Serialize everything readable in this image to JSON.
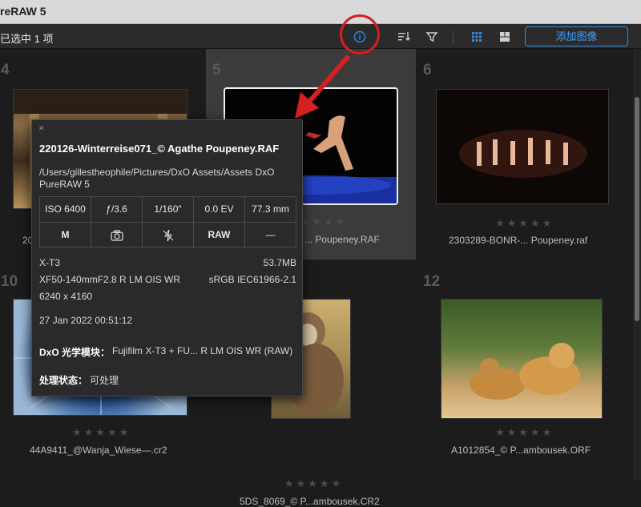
{
  "window": {
    "title": "reRAW 5"
  },
  "toolbar": {
    "selection_text": "已选中 1 项",
    "add_images_label": "添加图像",
    "icons": [
      "info-icon",
      "sort-icon",
      "filter-icon",
      "grid-view-icon",
      "compare-view-icon"
    ],
    "accent_color": "#2d8ce6"
  },
  "grid": {
    "cells": [
      {
        "number": "4",
        "stars": "★★★★★",
        "filename": "20"
      },
      {
        "number": "5",
        "stars": "★★★★★",
        "filename": "... Poupeney.RAF"
      },
      {
        "number": "6",
        "stars": "★★★★★",
        "filename": "2303289-BONR-... Poupeney.raf"
      },
      {
        "number": "10",
        "stars": "★★★★★",
        "filename": "44A9411_@Wanja_Wiese—.cr2"
      },
      {
        "number": "",
        "stars": "★★★★★",
        "filename": "5DS_8069_© P...ambousek.CR2"
      },
      {
        "number": "12",
        "stars": "★★★★★",
        "filename": "A1012854_© P...ambousek.ORF"
      }
    ],
    "partial_fname_r": "r"
  },
  "info_popup": {
    "close_glyph": "×",
    "title": "220126-Winterreise071_© Agathe Poupeney.RAF",
    "path": "/Users/gillestheophile/Pictures/DxO Assets/Assets DxO PureRAW 5",
    "exif": {
      "iso": "ISO 6400",
      "aperture": "ƒ/3.6",
      "shutter": "1/160\"",
      "exposure_comp": "0.0 EV",
      "focal_length": "77.3 mm",
      "mode": "M",
      "flash_label": "—"
    },
    "camera": "X-T3",
    "file_size": "53.7MB",
    "lens": "XF50-140mmF2.8 R LM OIS WR",
    "color_space": "sRGB IEC61966-2.1",
    "dimensions": "6240 x 4160",
    "date": "27 Jan 2022 00:51:12",
    "module_label": "DxO 光学模块：",
    "module_value": "Fujifilm X-T3 + FU... R LM OIS WR (RAW)",
    "status_label": "处理状态：",
    "status_value": "可处理"
  },
  "annotation": {
    "color": "#d42020"
  }
}
